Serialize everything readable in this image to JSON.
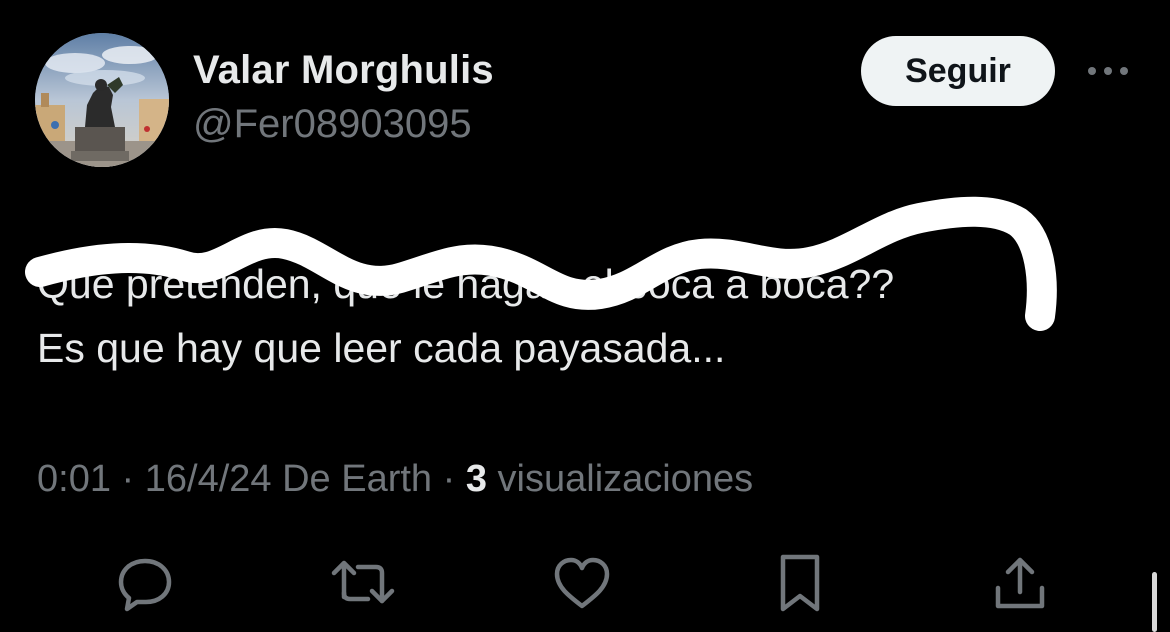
{
  "author": {
    "display_name": "Valar Morghulis",
    "handle": "@Fer08903095",
    "avatar_icon": "bear-statue-avatar"
  },
  "header": {
    "follow_label": "Seguir",
    "more_icon": "more-options-icon"
  },
  "tweet": {
    "lines": [
      "Que pretenden, que le hagan el boca a boca??",
      "Es que hay que leer cada payasada..."
    ],
    "scribble_color": "#ffffff"
  },
  "meta": {
    "time": "0:01",
    "separator": " · ",
    "date_source": "16/4/24 De Earth",
    "views_count": "3",
    "views_label": " visualizaciones"
  },
  "actions": [
    {
      "icon": "reply-icon"
    },
    {
      "icon": "retweet-icon"
    },
    {
      "icon": "like-icon"
    },
    {
      "icon": "bookmark-icon"
    },
    {
      "icon": "share-icon"
    }
  ],
  "colors": {
    "background": "#000000",
    "primary_text": "#e7e9ea",
    "secondary_text": "#71767b",
    "button_bg": "#eff3f4",
    "button_text": "#0f1419"
  }
}
